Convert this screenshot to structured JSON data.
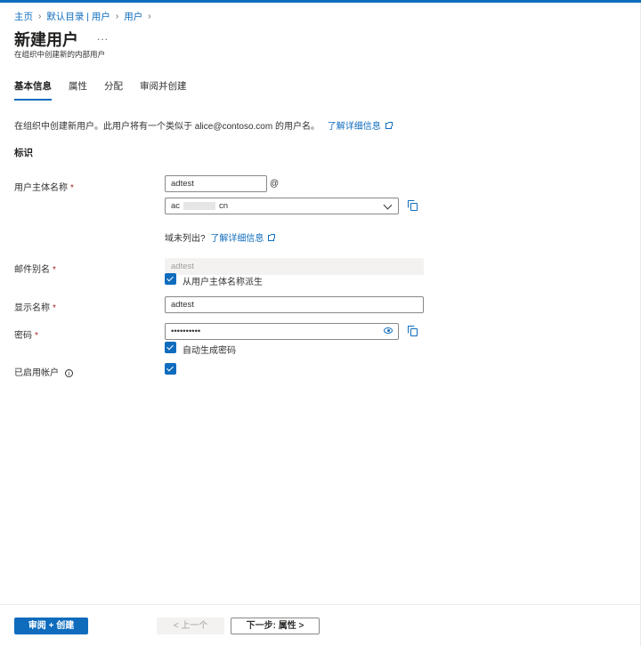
{
  "breadcrumb": {
    "home": "主页",
    "directory": "默认目录 | 用户",
    "users": "用户"
  },
  "page": {
    "title": "新建用户",
    "more": "...",
    "subtitle": "在组织中创建新的内部用户"
  },
  "tabs": [
    {
      "label": "基本信息",
      "active": true
    },
    {
      "label": "属性",
      "active": false
    },
    {
      "label": "分配",
      "active": false
    },
    {
      "label": "审阅并创建",
      "active": false
    }
  ],
  "intro": {
    "text": "在组织中创建新用户。此用户将有一个类似于 alice@contoso.com 的用户名。",
    "link": "了解详细信息"
  },
  "section": {
    "title": "标识"
  },
  "form": {
    "upn": {
      "label": "用户主体名称",
      "required": "*",
      "value": "adtest",
      "at": "@",
      "domain_prefix": "ac",
      "domain_suffix": "cn"
    },
    "domain_note": {
      "text": "域未列出?",
      "link": "了解详细信息"
    },
    "mail_nickname": {
      "label": "邮件别名",
      "required": "*",
      "value": "adtest",
      "checkbox_label": "从用户主体名称派生",
      "checked": true
    },
    "display_name": {
      "label": "显示名称",
      "required": "*",
      "value": "adtest"
    },
    "password": {
      "label": "密码",
      "required": "*",
      "value": "••••••••••",
      "checkbox_label": "自动生成密码",
      "checked": true
    },
    "account_enabled": {
      "label": "已启用帐户",
      "info": "i",
      "checked": true
    }
  },
  "footer": {
    "primary": "审阅 + 创建",
    "prev": "< 上一个",
    "next": "下一步: 属性  >"
  },
  "colors": {
    "accent": "#0f6cbd",
    "required": "#a4262c"
  }
}
